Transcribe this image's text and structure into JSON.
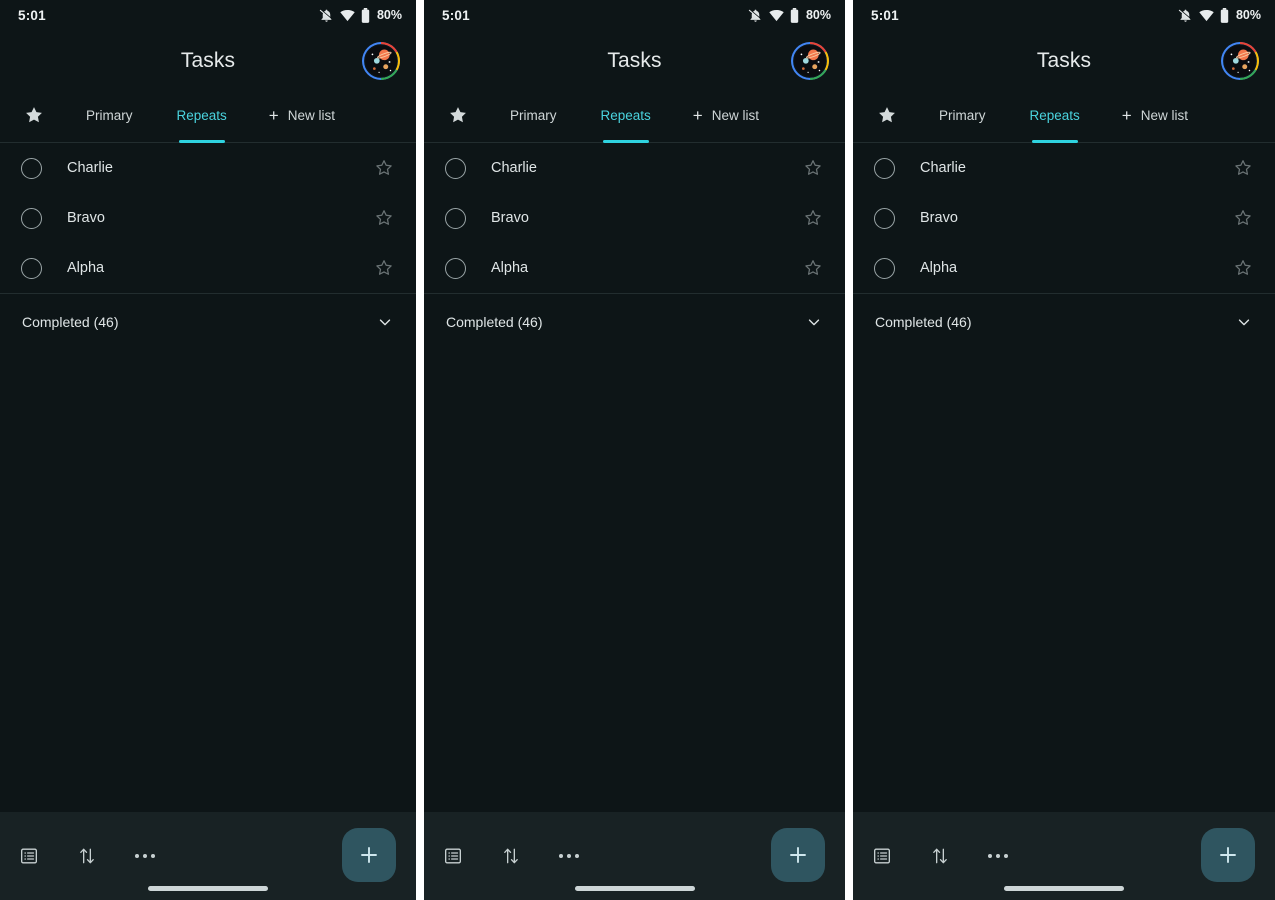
{
  "theme": {
    "background": "#0d1517",
    "bottom_bar": "#182224",
    "accent_teal": "#4ad3de",
    "indicator_teal": "#2fd3e0",
    "fab_bg": "#2f5560",
    "divider": "#222d2f",
    "text_primary": "#dfe5e6",
    "text_secondary": "#cfd6d7"
  },
  "status_bar": {
    "time": "5:01",
    "battery_percent": "80%",
    "icons": [
      "bell-muted-icon",
      "wifi-icon",
      "battery-icon"
    ]
  },
  "app_bar": {
    "title": "Tasks",
    "avatar_name": "account-avatar"
  },
  "tabs": {
    "star_tab_name": "starred-tab",
    "items": [
      {
        "label": "Primary",
        "active": false
      },
      {
        "label": "Repeats",
        "active": true
      }
    ],
    "new_list": {
      "label": "New list",
      "plus": "+"
    }
  },
  "tasks": [
    {
      "label": "Charlie",
      "checked": false,
      "starred": false
    },
    {
      "label": "Bravo",
      "checked": false,
      "starred": false
    },
    {
      "label": "Alpha",
      "checked": false,
      "starred": false
    }
  ],
  "completed": {
    "label": "Completed (46)",
    "expanded": false,
    "chevron": "chevron-down-icon"
  },
  "bottom_bar": {
    "buttons": [
      {
        "name": "list-view-icon"
      },
      {
        "name": "sort-icon"
      },
      {
        "name": "more-options-icon"
      }
    ],
    "fab": {
      "name": "add-task-fab",
      "glyph": "+"
    }
  },
  "screens": [
    {
      "id": "screen-1"
    },
    {
      "id": "screen-2"
    },
    {
      "id": "screen-3"
    }
  ]
}
